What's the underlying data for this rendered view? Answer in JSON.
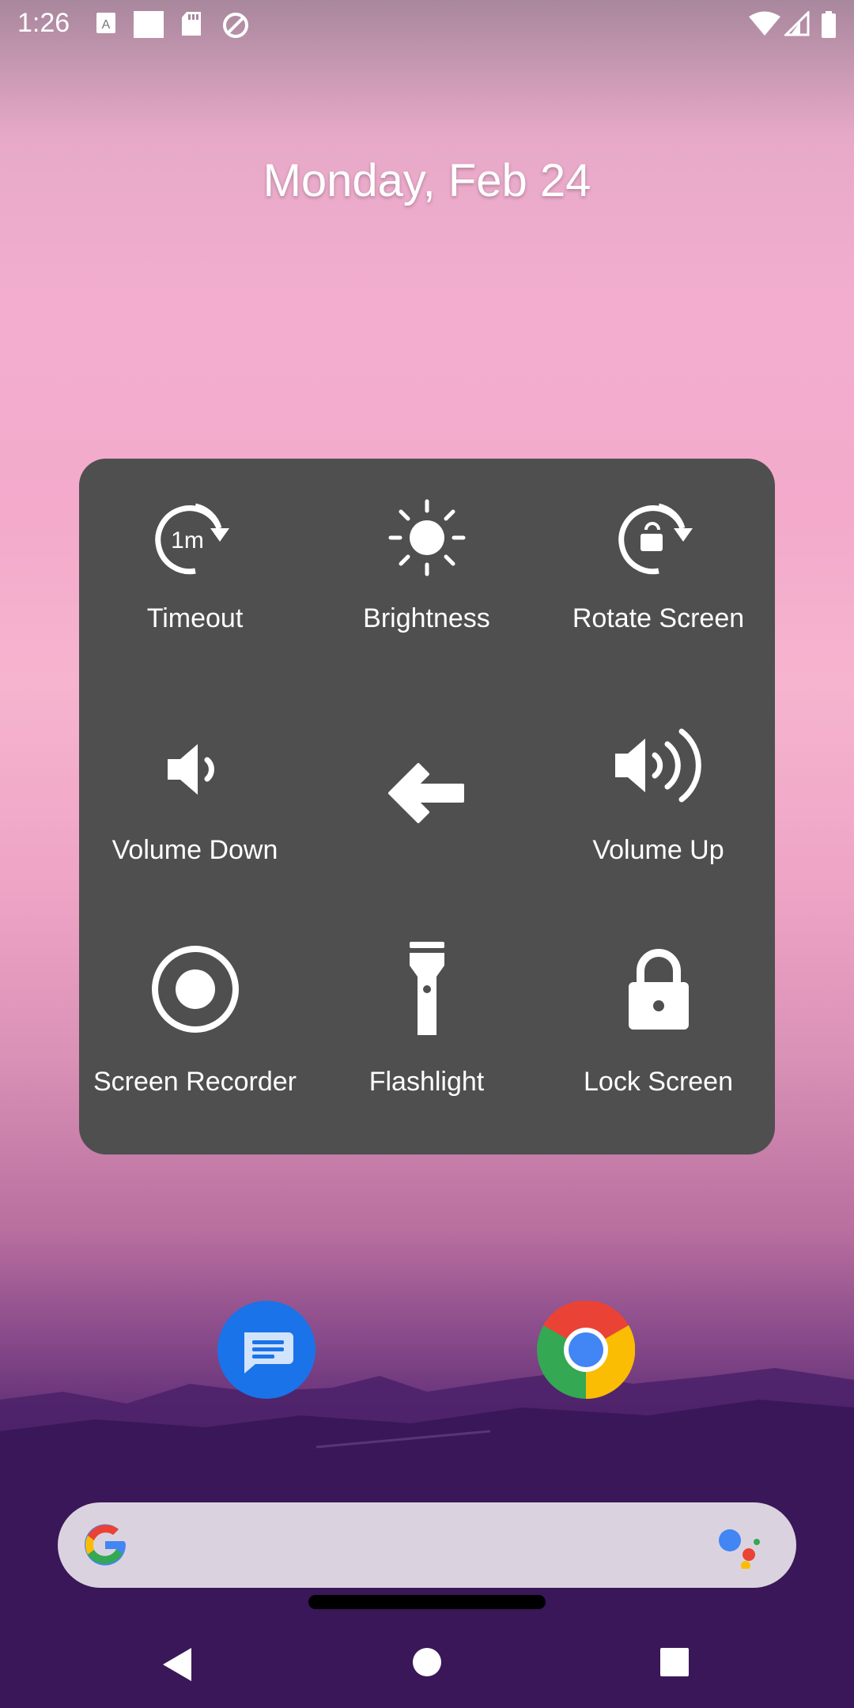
{
  "status_bar": {
    "time": "1:26"
  },
  "home": {
    "date": "Monday, Feb 24"
  },
  "accessibility_menu": {
    "tiles": [
      {
        "label": "Timeout",
        "icon": "timeout-icon",
        "badge": "1m"
      },
      {
        "label": "Brightness",
        "icon": "brightness-icon"
      },
      {
        "label": "Rotate Screen",
        "icon": "rotate-screen-icon"
      },
      {
        "label": "Volume Down",
        "icon": "volume-down-icon"
      },
      {
        "label": "",
        "icon": "back-arrow-icon"
      },
      {
        "label": "Volume Up",
        "icon": "volume-up-icon"
      },
      {
        "label": "Screen Recorder",
        "icon": "screen-recorder-icon"
      },
      {
        "label": "Flashlight",
        "icon": "flashlight-icon"
      },
      {
        "label": "Lock Screen",
        "icon": "lock-screen-icon"
      }
    ],
    "panel_color": "#4f4f4f"
  },
  "dock": [
    {
      "app": "Messages",
      "icon": "messages-icon",
      "color": "#1a73e8"
    },
    {
      "app": "Chrome",
      "icon": "chrome-icon"
    }
  ],
  "search_bar": {
    "icon_left": "google-g-icon",
    "icon_right": "google-assistant-icon"
  },
  "nav_bar": {
    "buttons": [
      "back-button",
      "home-button",
      "recents-button"
    ]
  }
}
